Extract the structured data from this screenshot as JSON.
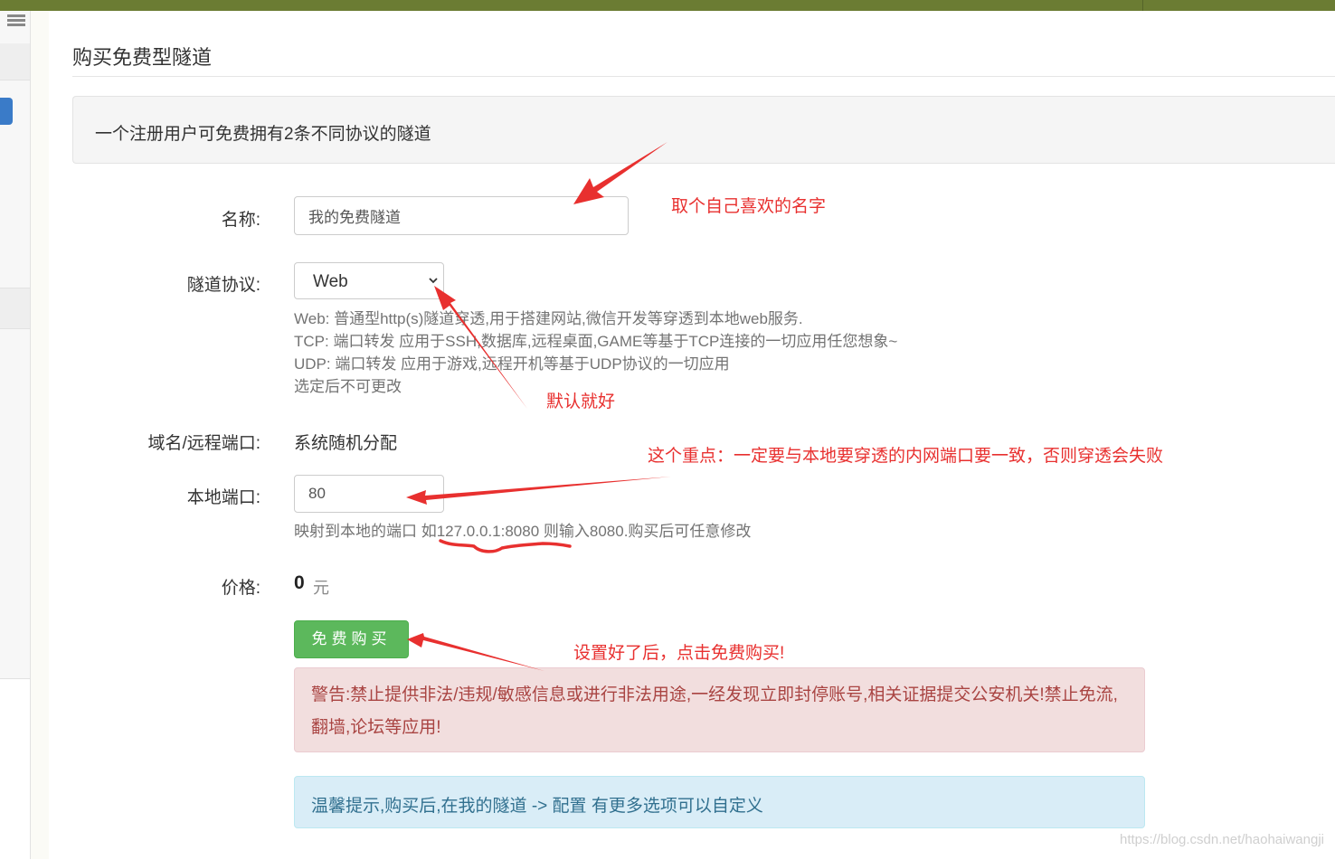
{
  "page": {
    "title": "购买免费型隧道",
    "info": "一个注册用户可免费拥有2条不同协议的隧道"
  },
  "form": {
    "name": {
      "label": "名称:",
      "value": "我的免费隧道"
    },
    "protocol": {
      "label": "隧道协议:",
      "selected": "Web",
      "help": [
        "Web: 普通型http(s)隧道穿透,用于搭建网站,微信开发等穿透到本地web服务.",
        "TCP: 端口转发 应用于SSH,数据库,远程桌面,GAME等基于TCP连接的一切应用任您想象~",
        "UDP: 端口转发 应用于游戏,远程开机等基于UDP协议的一切应用",
        "选定后不可更改"
      ]
    },
    "domain": {
      "label": "域名/远程端口:",
      "value": "系统随机分配"
    },
    "local_port": {
      "label": "本地端口:",
      "value": "80",
      "help": "映射到本地的端口 如127.0.0.1:8080 则输入8080.购买后可任意修改"
    },
    "price": {
      "label": "价格:",
      "value": "0",
      "unit": "元"
    },
    "buy_button": "免费购买"
  },
  "alerts": {
    "danger": "警告:禁止提供非法/违规/敏感信息或进行非法用途,一经发现立即封停账号,相关证据提交公安机关!禁止免流,翻墙,论坛等应用!",
    "info": "温馨提示,购买后,在我的隧道 -> 配置 有更多选项可以自定义"
  },
  "annotations": {
    "name_hint": "取个自己喜欢的名字",
    "protocol_hint": "默认就好",
    "port_hint": "这个重点：一定要与本地要穿透的内网端口要一致，否则穿透会失败",
    "buy_hint": "设置好了后，点击免费购买!"
  },
  "watermark": "https://blog.csdn.net/haohaiwangji",
  "colors": {
    "header_bar": "#6b7c33",
    "success": "#5cb85c",
    "danger_bg": "#f2dede",
    "danger_text": "#a94442",
    "info_bg": "#d9edf7",
    "info_text": "#31708f",
    "annotation": "#e8302f"
  }
}
